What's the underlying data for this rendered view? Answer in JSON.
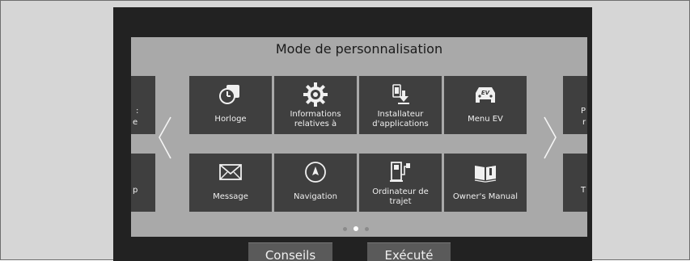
{
  "panel": {
    "title": "Mode de personnalisation"
  },
  "grid": {
    "row1": [
      {
        "label": "Horloge",
        "icon": "clock-icon"
      },
      {
        "label": "Informations relatives à",
        "icon": "gear-info-icon"
      },
      {
        "label": "Installateur d'applications",
        "icon": "app-installer-icon"
      },
      {
        "label": "Menu EV",
        "icon": "ev-car-icon"
      }
    ],
    "row2": [
      {
        "label": "Message",
        "icon": "envelope-icon"
      },
      {
        "label": "Navigation",
        "icon": "compass-icon"
      },
      {
        "label": "Ordinateur de trajet",
        "icon": "trip-computer-icon"
      },
      {
        "label": "Owner's Manual",
        "icon": "manual-icon"
      }
    ],
    "left_partial": {
      "row1_line1": ":",
      "row1_line2": "e",
      "row2": "p"
    },
    "right_partial": {
      "row1_line1": "P",
      "row1_line2": "r",
      "row2": "T"
    }
  },
  "pagination": {
    "pages": 3,
    "current": 2
  },
  "buttons": {
    "tips": "Conseils",
    "done": "Exécuté"
  },
  "colors": {
    "screen_bg": "#222222",
    "panel_bg": "#a9a9a9",
    "tile_bg": "#3f3f3f",
    "button_bg": "#5a5a5a"
  }
}
